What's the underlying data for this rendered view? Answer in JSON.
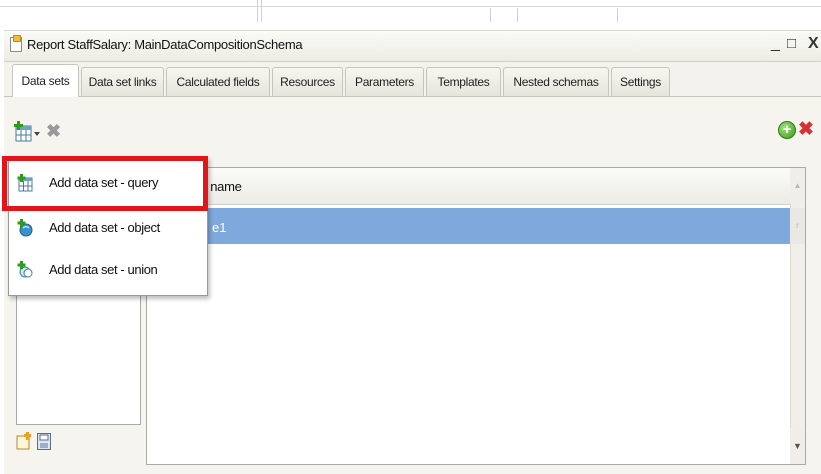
{
  "window": {
    "title": "Report StaffSalary: MainDataCompositionSchema",
    "minimize_label": "_",
    "maximize_label": "□",
    "close_label": "X"
  },
  "tabs": [
    {
      "label": "Data sets",
      "active": true
    },
    {
      "label": "Data set links",
      "active": false
    },
    {
      "label": "Calculated fields",
      "active": false
    },
    {
      "label": "Resources",
      "active": false
    },
    {
      "label": "Parameters",
      "active": false
    },
    {
      "label": "Templates",
      "active": false
    },
    {
      "label": "Nested schemas",
      "active": false
    },
    {
      "label": "Settings",
      "active": false
    }
  ],
  "toolbar": {
    "add_icon": "add-table-dropdown-icon",
    "delete_icon": "delete-icon",
    "right_add_icon": "green-plus-icon",
    "right_delete_icon": "red-x-icon",
    "delete_glyph": "✖",
    "right_add_glyph": "+",
    "right_delete_glyph": "✖"
  },
  "menu": {
    "items": [
      {
        "label": "Add data set - query",
        "icon": "table-add-icon"
      },
      {
        "label": "Add data set - object",
        "icon": "object-add-icon"
      },
      {
        "label": "Add data set - union",
        "icon": "union-add-icon"
      }
    ],
    "highlight_color": "#e0161a"
  },
  "grid": {
    "header": "e name",
    "rows": [
      {
        "text": "e1",
        "selected": true
      }
    ],
    "scroll_up": "▲",
    "scroll_mid": "r",
    "scroll_down": "▼"
  },
  "colors": {
    "selection": "#7fa9dd",
    "highlight": "#e0161a"
  }
}
